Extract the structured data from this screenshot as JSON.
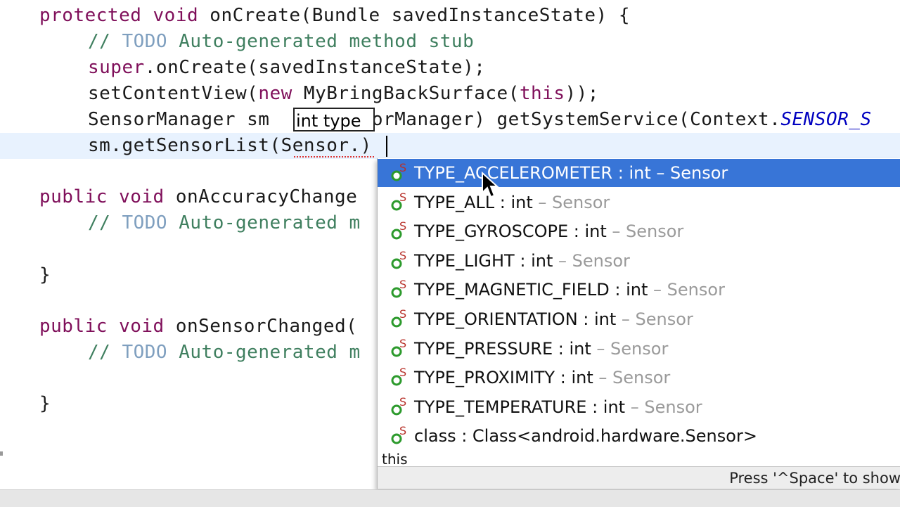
{
  "editor": {
    "lines": [
      {
        "parts": [
          "protected void",
          " onCreate(Bundle savedInstanceState) {"
        ]
      },
      {
        "comment_prefix": "// ",
        "todo": "TODO",
        "comment_rest": " Auto-generated method stub"
      },
      {
        "kw": "super",
        "rest": ".onCreate(savedInstanceState);"
      },
      {
        "pre": "setContentView(",
        "kw": "new",
        "mid": " MyBringBackSurface(",
        "kw2": "this",
        "post": "));"
      },
      {
        "pre": "SensorManager sm ",
        "gap": "        ",
        "post": "orManager) getSystemService(Context.",
        "ital": "SENSOR_S"
      },
      {
        "text": "sm.getSensorList(Sensor.)"
      },
      {
        "kw": "public void",
        "rest": " onAccuracyChange"
      },
      {
        "comment_prefix": "// ",
        "todo": "TODO",
        "comment_rest": " Auto-generated m"
      },
      {
        "text": "}"
      },
      {
        "kw": "public void",
        "rest": " onSensorChanged("
      },
      {
        "comment_prefix": "// ",
        "todo": "TODO",
        "comment_rest": " Auto-generated m"
      },
      {
        "text": "}"
      }
    ],
    "param_hint": "int type"
  },
  "autocomplete": {
    "items": [
      {
        "name": "TYPE_ACCELEROMETER",
        "type": " : int",
        "owner": " – Sensor",
        "selected": true
      },
      {
        "name": "TYPE_ALL",
        "type": " : int",
        "owner": " – Sensor"
      },
      {
        "name": "TYPE_GYROSCOPE",
        "type": " : int",
        "owner": " – Sensor"
      },
      {
        "name": "TYPE_LIGHT",
        "type": " : int",
        "owner": " – Sensor"
      },
      {
        "name": "TYPE_MAGNETIC_FIELD",
        "type": " : int",
        "owner": " – Sensor"
      },
      {
        "name": "TYPE_ORIENTATION",
        "type": " : int",
        "owner": " – Sensor"
      },
      {
        "name": "TYPE_PRESSURE",
        "type": " : int",
        "owner": " – Sensor"
      },
      {
        "name": "TYPE_PROXIMITY",
        "type": " : int",
        "owner": " – Sensor"
      },
      {
        "name": "TYPE_TEMPERATURE",
        "type": " : int",
        "owner": " – Sensor"
      },
      {
        "name": "class",
        "type": " : Class<android.hardware.Sensor>",
        "owner": ""
      }
    ],
    "partial_item": "this",
    "status_text": "Press '^Space' to show"
  },
  "icons": {
    "static_field": "static-field-icon",
    "pointer": "mouse-pointer-icon"
  },
  "colors": {
    "selection": "#3875d7",
    "keyword": "#7f0f5a",
    "comment": "#3f7f5f",
    "todo": "#7f9fbf",
    "constant": "#0000c0",
    "current_line": "#e8f2fe"
  }
}
